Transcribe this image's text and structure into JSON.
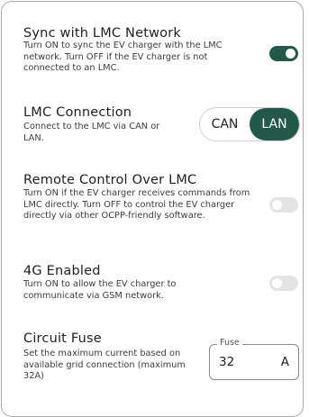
{
  "sync": {
    "title": "Sync with LMC Network",
    "description": "Turn ON to sync the EV charger with the LMC network. Turn OFF if the EV charger is not connected to an LMC.",
    "enabled": true
  },
  "lmc_connection": {
    "title": "LMC Connection",
    "description": "Connect to the LMC via CAN or LAN.",
    "options": [
      "CAN",
      "LAN"
    ],
    "selected": "LAN"
  },
  "remote_control": {
    "title": "Remote Control Over LMC",
    "description": "Turn ON if the EV charger receives commands from LMC directly. Turn OFF to control the EV charger directly via other OCPP-friendly software.",
    "enabled": false
  },
  "four_g": {
    "title": "4G Enabled",
    "description": "Turn ON to allow the EV charger to communicate via GSM network.",
    "enabled": false
  },
  "circuit_fuse": {
    "title": "Circuit Fuse",
    "description": "Set the maximum current based on available grid connection (maximum 32A)",
    "field_label": "Fuse",
    "value": "32",
    "unit": "A"
  },
  "colors": {
    "accent": "#23594a",
    "toggle_off": "#e3e3e3"
  }
}
